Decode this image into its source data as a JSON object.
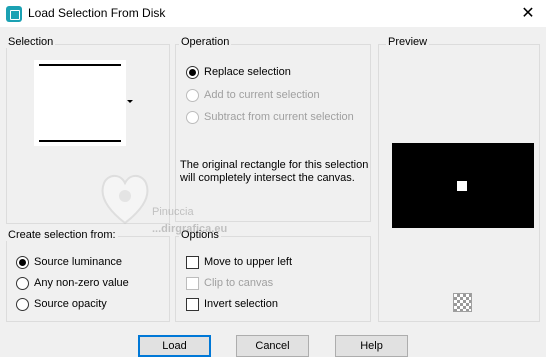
{
  "window": {
    "title": "Load Selection From Disk",
    "close_glyph": "✕"
  },
  "selection": {
    "label": "Selection"
  },
  "operation": {
    "label": "Operation",
    "options": [
      {
        "label": "Replace selection",
        "checked": true,
        "enabled": true
      },
      {
        "label": "Add to current selection",
        "checked": false,
        "enabled": false
      },
      {
        "label": "Subtract from current selection",
        "checked": false,
        "enabled": false
      }
    ],
    "info": "The original rectangle for this selection will completely intersect the canvas."
  },
  "preview": {
    "label": "Preview"
  },
  "create_from": {
    "label": "Create selection from:",
    "options": [
      {
        "label": "Source luminance",
        "checked": true
      },
      {
        "label": "Any non-zero value",
        "checked": false
      },
      {
        "label": "Source opacity",
        "checked": false
      }
    ]
  },
  "options": {
    "label": "Options",
    "items": [
      {
        "label": "Move to upper left",
        "checked": false,
        "enabled": true
      },
      {
        "label": "Clip to canvas",
        "checked": false,
        "enabled": false
      },
      {
        "label": "Invert selection",
        "checked": false,
        "enabled": true
      }
    ]
  },
  "buttons": {
    "load": "Load",
    "cancel": "Cancel",
    "help": "Help"
  },
  "watermark": {
    "name": "Pinuccia",
    "url": "www.pinuccia.net",
    "url_partial": "...dirgrafica.eu"
  },
  "colors": {
    "accent": "#0078d7",
    "app_icon": "#1ba1b3",
    "preview_bg": "#000000"
  }
}
